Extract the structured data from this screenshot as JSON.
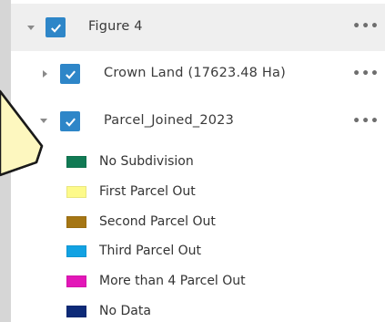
{
  "layers": {
    "group": {
      "label": "Figure 4",
      "more": "•••",
      "checked": true,
      "expanded": true
    },
    "crown_land": {
      "label": "Crown Land (17623.48 Ha)",
      "more": "•••",
      "checked": true,
      "expanded": false
    },
    "parcel_joined": {
      "label": "Parcel_Joined_2023",
      "more": "•••",
      "checked": true,
      "expanded": true
    }
  },
  "legend": [
    {
      "label": "No Subdivision",
      "color": "#117a54"
    },
    {
      "label": "First Parcel Out",
      "color": "#fdfa8a"
    },
    {
      "label": "Second Parcel Out",
      "color": "#a57614"
    },
    {
      "label": "Third Parcel Out",
      "color": "#12a2e3"
    },
    {
      "label": "More than 4 Parcel Out",
      "color": "#e317b8"
    },
    {
      "label": "No Data",
      "color": "#0d2a78"
    }
  ],
  "colors": {
    "accent": "#2e86c8",
    "callout_fill": "#fdf7bf"
  },
  "icons": {
    "expand": "caret-icon",
    "check": "checkmark-icon",
    "options": "ellipsis-icon"
  }
}
